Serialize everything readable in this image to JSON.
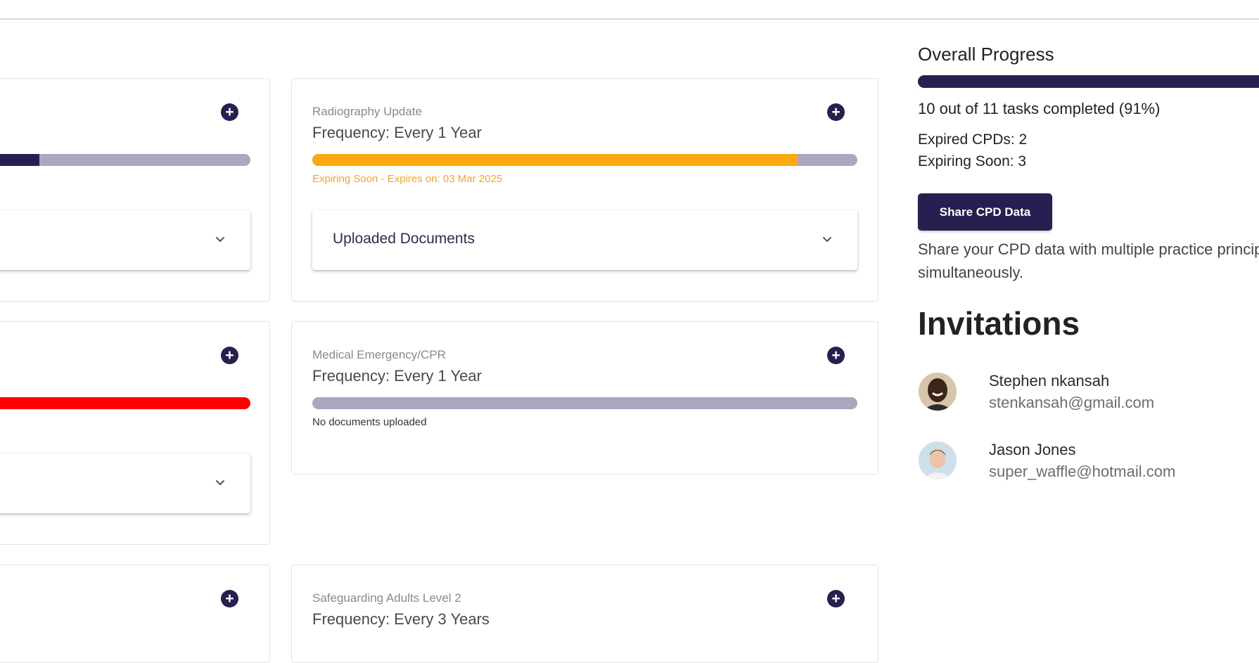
{
  "cards": {
    "left1": {
      "progress": 0.2,
      "bar_color": "#262050"
    },
    "left2": {
      "progress": 1.0,
      "bar_color": "#ff0000"
    },
    "radiography": {
      "title": "Radiography Update",
      "frequency": "Frequency: Every 1 Year",
      "progress": 0.89,
      "bar_color": "#fca80e",
      "status": "Expiring Soon - Expires on: 03 Mar 2025",
      "status_color": "#f0a32a",
      "accordion_label": "Uploaded Documents"
    },
    "medical": {
      "title": "Medical Emergency/CPR",
      "frequency": "Frequency: Every 1 Year",
      "progress": 0,
      "status": "No documents uploaded",
      "status_color": "#333333"
    },
    "safeguarding": {
      "title": "Safeguarding Adults Level 2",
      "frequency": "Frequency: Every 3 Years"
    }
  },
  "overall": {
    "title": "Overall Progress",
    "progress": 0.91,
    "summary": "10 out of 11 tasks completed (91%)",
    "expired": "Expired CPDs: 2",
    "expiring": "Expiring Soon: 3",
    "share_button": "Share CPD Data",
    "share_desc": "Share your CPD data with multiple practice principals simultaneously."
  },
  "invitations": {
    "title": "Invitations",
    "people": [
      {
        "name": "Stephen nkansah",
        "email": "stenkansah@gmail.com"
      },
      {
        "name": "Jason Jones",
        "email": "super_waffle@hotmail.com"
      }
    ]
  },
  "colors": {
    "brand": "#262050",
    "track": "#a9a8bd"
  },
  "icons": {
    "add": "plus-circle-icon",
    "expand": "chevron-down-icon"
  }
}
